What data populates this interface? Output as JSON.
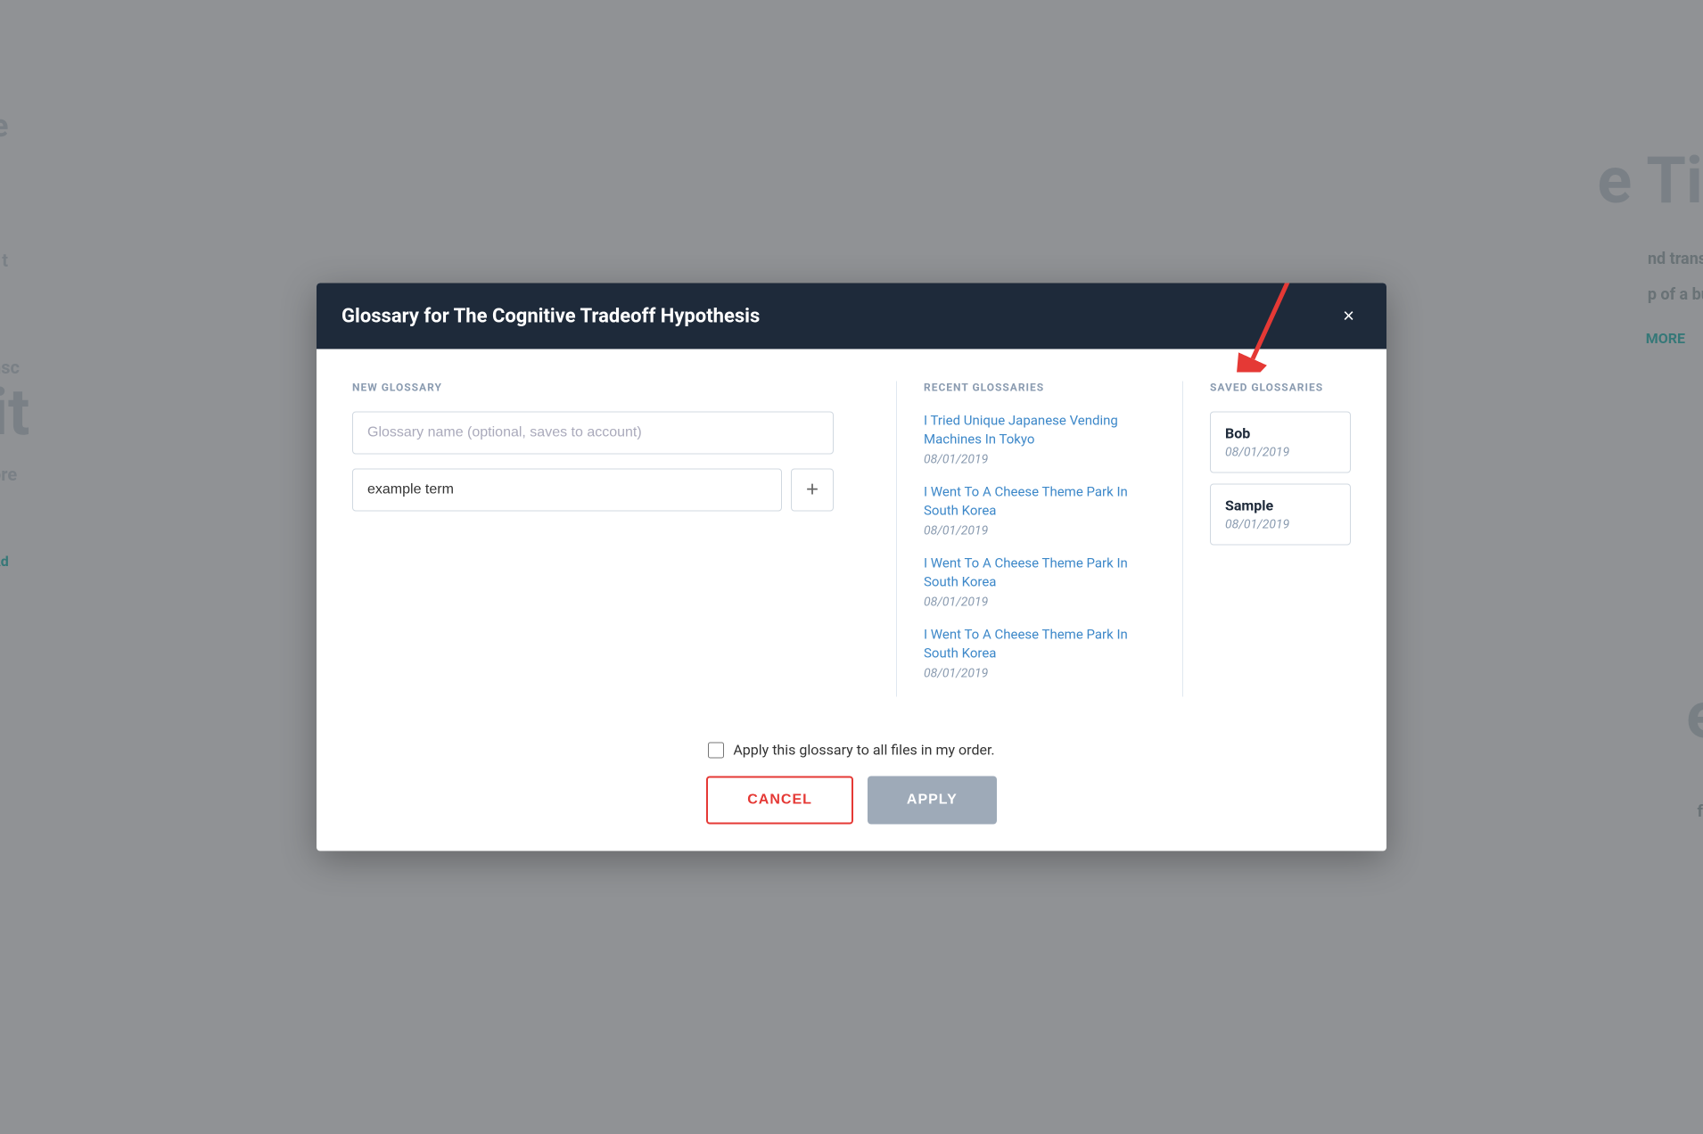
{
  "modal": {
    "title": "Glossary for The Cognitive Tradeoff Hypothesis",
    "close_label": "×"
  },
  "new_glossary": {
    "section_label": "NEW GLOSSARY",
    "name_placeholder": "Glossary name (optional, saves to account)",
    "term_value": "example term",
    "add_icon": "+"
  },
  "recent_glossaries": {
    "section_label": "RECENT GLOSSARIES",
    "items": [
      {
        "title": "I Tried Unique Japanese Vending Machines In Tokyo",
        "date": "08/01/2019"
      },
      {
        "title": "I Went To A Cheese Theme Park In South Korea",
        "date": "08/01/2019"
      },
      {
        "title": "I Went To A Cheese Theme Park In South Korea",
        "date": "08/01/2019"
      },
      {
        "title": "I Went To A Cheese Theme Park In South Korea",
        "date": "08/01/2019"
      }
    ]
  },
  "saved_glossaries": {
    "section_label": "SAVED GLOSSARIES",
    "items": [
      {
        "title": "Bob",
        "date": "08/01/2019"
      },
      {
        "title": "Sample",
        "date": "08/01/2019"
      }
    ]
  },
  "footer": {
    "apply_all_label": "Apply this glossary to all files in my order.",
    "cancel_label": "CANCEL",
    "apply_label": "APPLY"
  }
}
